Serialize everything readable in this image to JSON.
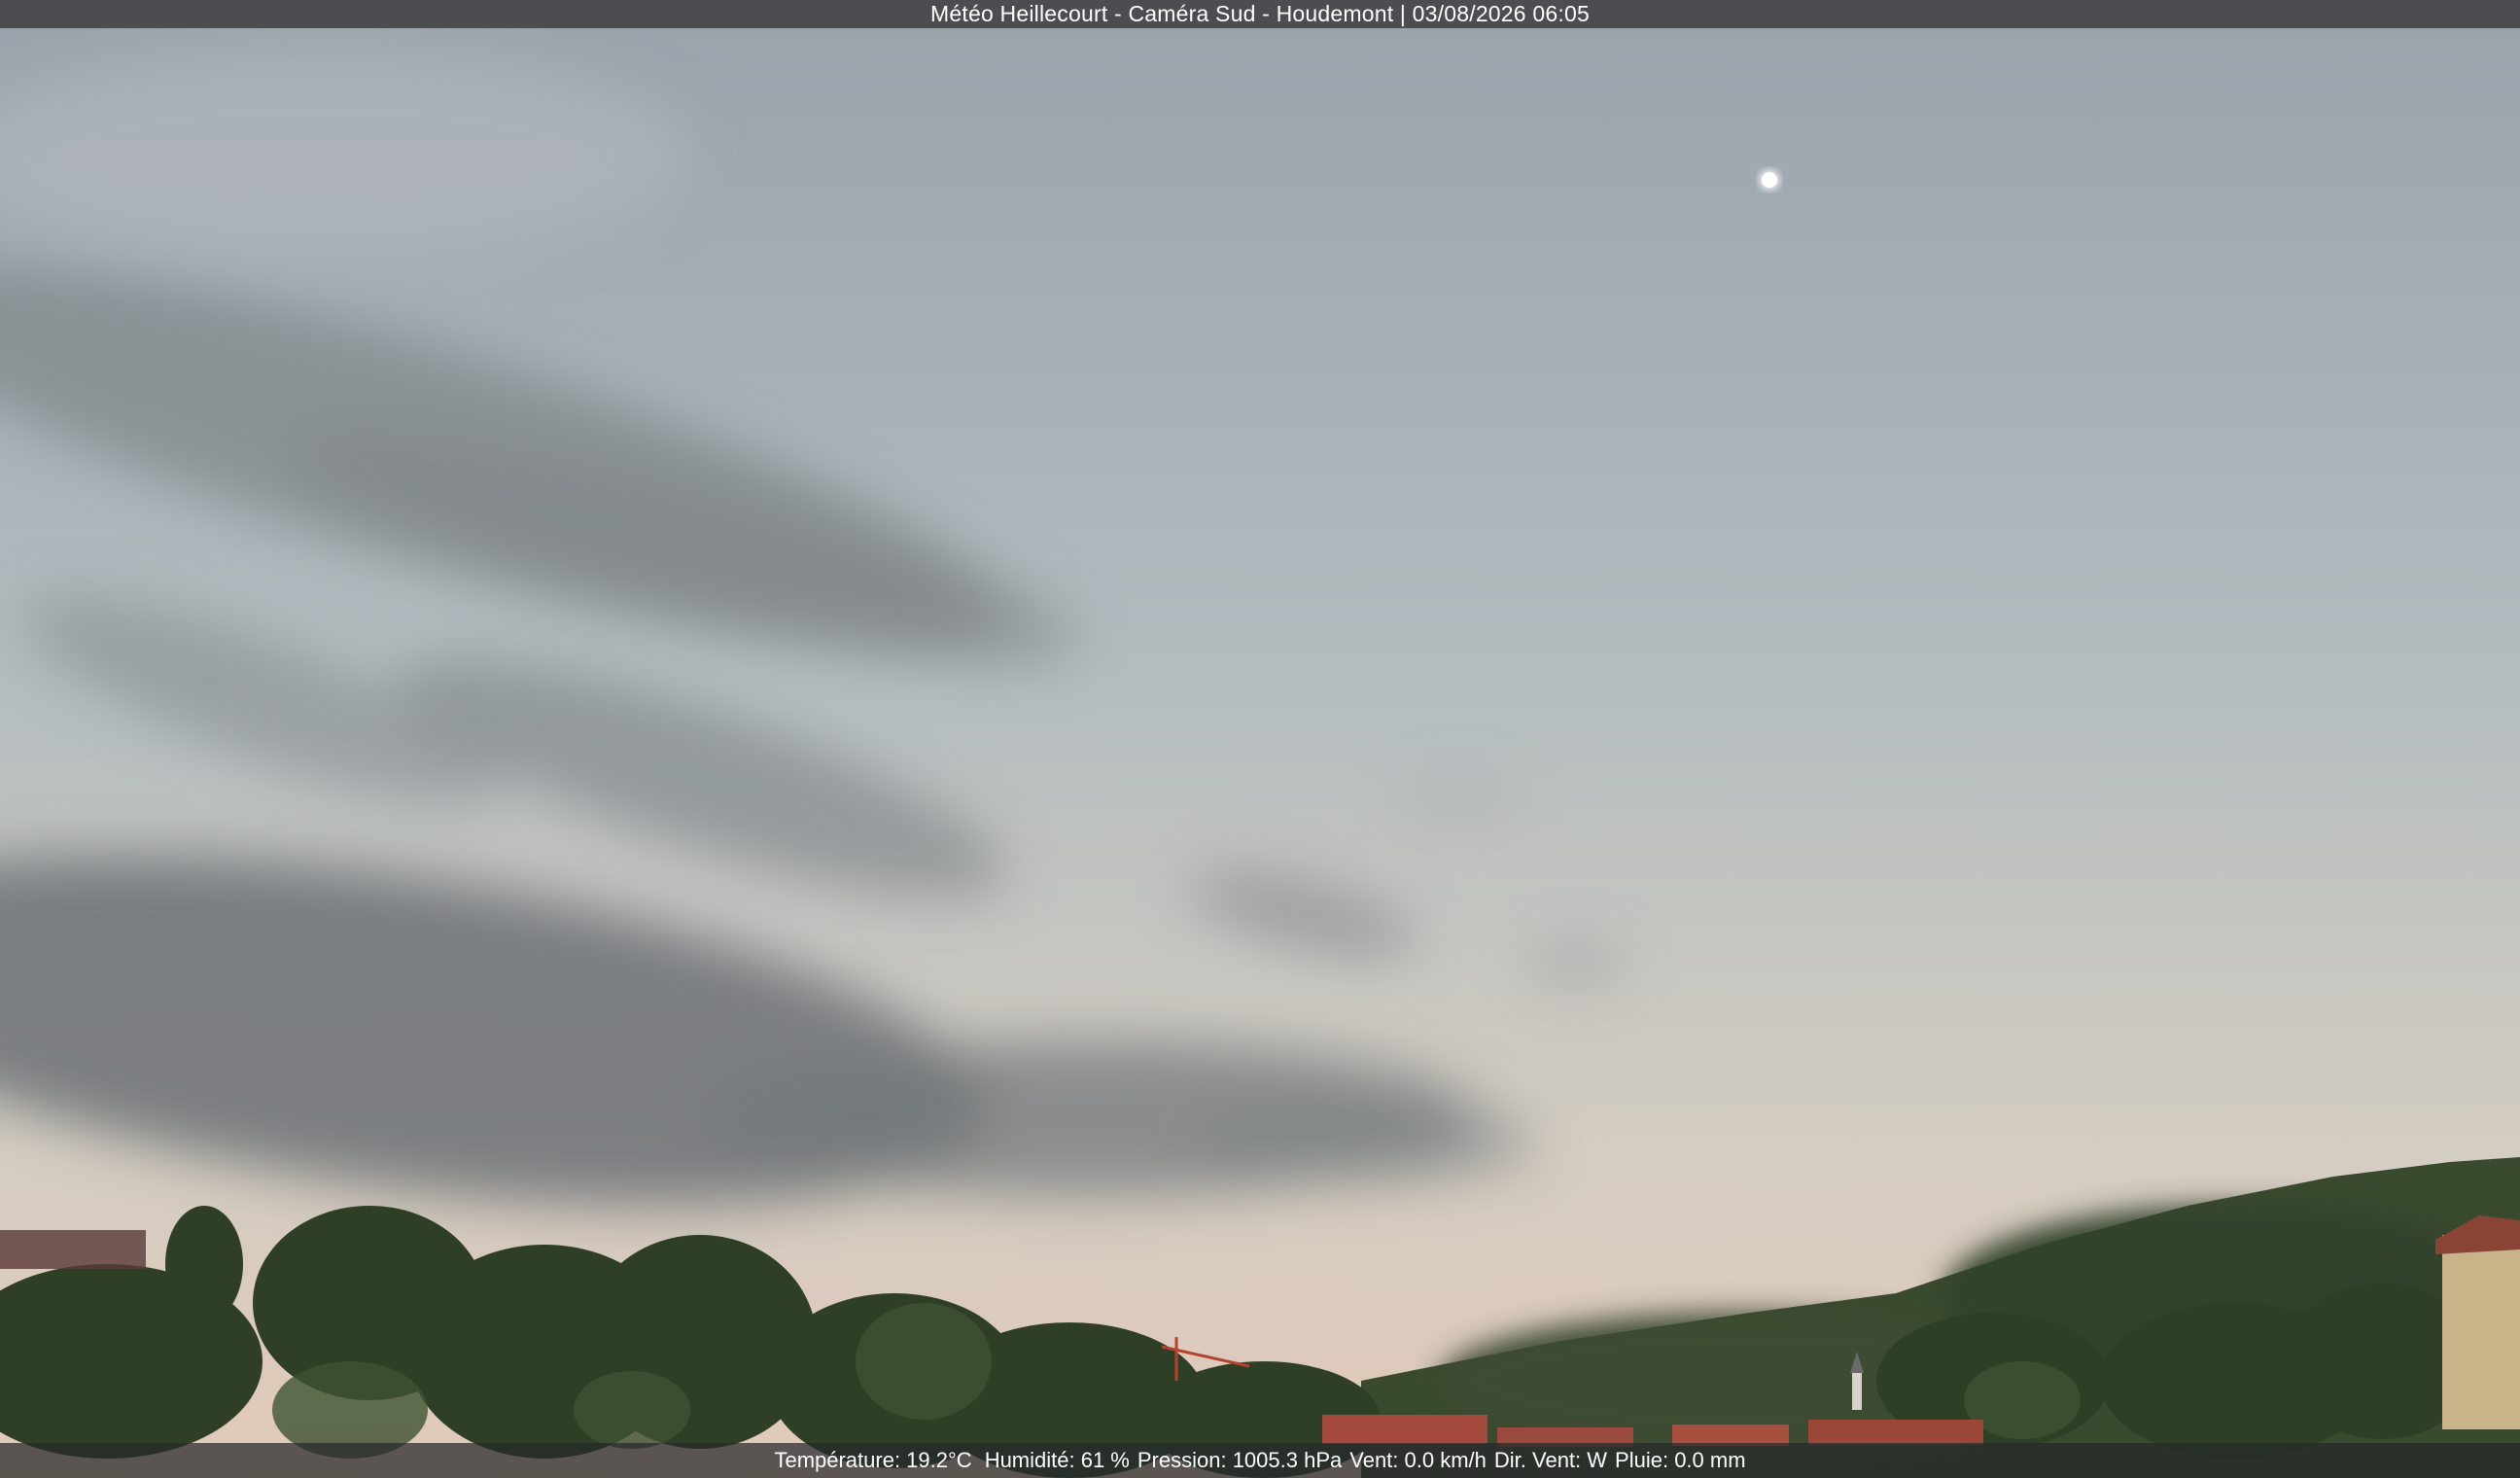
{
  "header": {
    "title": "Météo Heillecourt - Caméra Sud - Houdemont | 03/08/2026 06:05"
  },
  "weather": {
    "temperature": "Température: 19.2°C",
    "humidity": "Humidité: 61 %",
    "pressure": "Pression: 1005.3 hPa",
    "wind": "Vent: 0.0 km/h",
    "direction": "Dir. Vent: W",
    "rain": "Pluie: 0.0 mm"
  },
  "scene": {
    "sky_top": "#9ba3ab",
    "sky_mid": "#b8c0c0",
    "sky_horizon": "#dcc8b8",
    "cloud": "#6f7478",
    "trees": "#2e3d26",
    "roofs": "#a0463a",
    "moon": "#ffffff"
  }
}
